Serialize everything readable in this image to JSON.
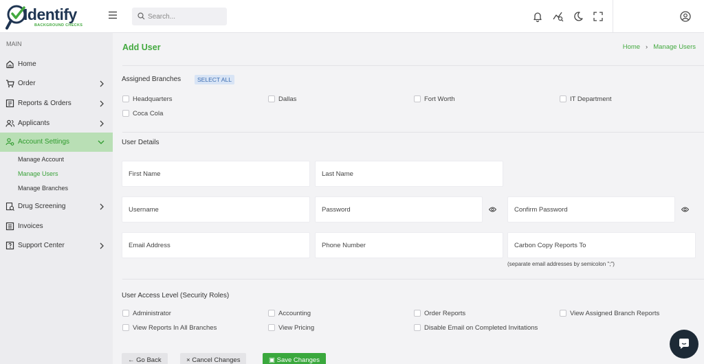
{
  "brand": {
    "name": "Identify",
    "tagline": "BACKGROUND CHECKS",
    "primary_color": "#43a93f",
    "navy": "#1f3552"
  },
  "header": {
    "search_placeholder": "Search...",
    "icons": [
      "menu-icon",
      "search-icon",
      "bell-icon",
      "analytics-icon",
      "moon-icon",
      "fullscreen-icon",
      "user-circle-icon"
    ]
  },
  "sidebar": {
    "heading": "MAIN",
    "items": [
      {
        "label": "Home",
        "icon": "home-icon"
      },
      {
        "label": "Order",
        "icon": "cart-icon"
      },
      {
        "label": "Reports & Orders",
        "icon": "report-icon"
      },
      {
        "label": "Applicants",
        "icon": "users-icon"
      },
      {
        "label": "Account Settings",
        "icon": "account-settings-icon",
        "active": true
      },
      {
        "label": "Drug Screening",
        "icon": "drug-screening-icon"
      },
      {
        "label": "Invoices",
        "icon": "invoice-icon"
      },
      {
        "label": "Support Center",
        "icon": "support-icon"
      }
    ],
    "sub_items": [
      "Manage Account",
      "Manage Users",
      "Manage Branches"
    ],
    "active_sub": "Manage Users"
  },
  "main": {
    "title": "Add User",
    "breadcrumb": [
      "Home",
      "Manage Users"
    ],
    "assigned_branches": {
      "title": "Assigned Branches",
      "select_all": "SELECT ALL",
      "branches": [
        "Headquarters",
        "Dallas",
        "Fort Worth",
        "IT Department",
        "Coca Cola"
      ]
    },
    "user_details": {
      "title": "User Details",
      "fields": {
        "first_name": "First Name",
        "last_name": "Last Name",
        "username": "Username",
        "password": "Password",
        "confirm_password": "Confirm Password",
        "email": "Email Address",
        "phone": "Phone Number",
        "cc_reports": "Carbon Copy Reports To"
      },
      "cc_hint": "(separate email addresses by semicolon \";\")"
    },
    "access_level": {
      "title": "User Access Level (Security Roles)",
      "roles": [
        "Administrator",
        "Accounting",
        "Order Reports",
        "View Assigned Branch Reports",
        "View Reports In All Branches",
        "View Pricing",
        "Disable Email on Completed Invitations"
      ]
    },
    "buttons": {
      "go_back": "Go Back",
      "cancel": "Cancel Changes",
      "save": "Save Changes"
    }
  }
}
